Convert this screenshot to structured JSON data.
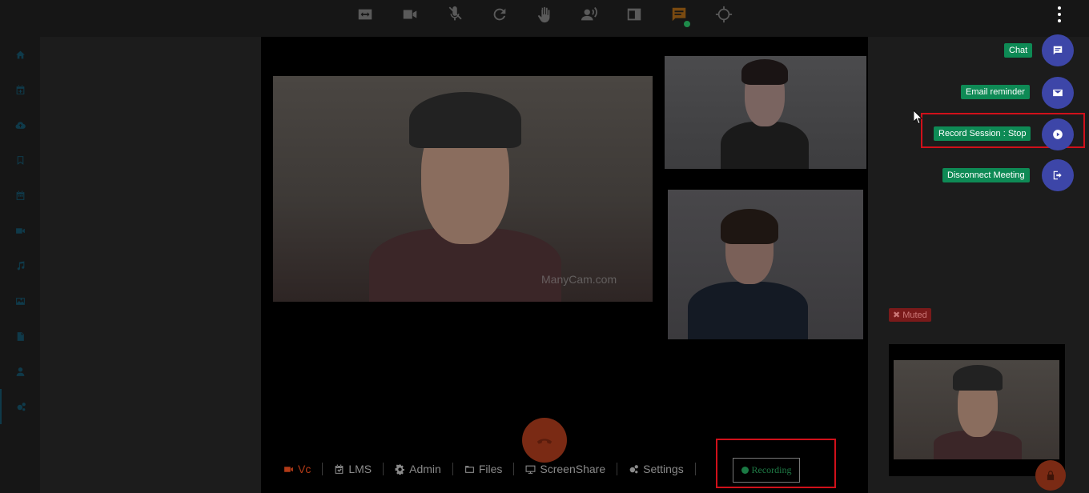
{
  "toolbar": {
    "items": [
      {
        "icon": "fit-screen-icon"
      },
      {
        "icon": "video-camera-icon"
      },
      {
        "icon": "mic-off-icon"
      },
      {
        "icon": "refresh-icon"
      },
      {
        "icon": "raise-hand-icon"
      },
      {
        "icon": "speaker-person-icon"
      },
      {
        "icon": "layout-icon"
      },
      {
        "icon": "chat-icon",
        "color": "#7a4a10"
      },
      {
        "icon": "crosshair-icon"
      }
    ],
    "chat_status_color": "#1e8a4a"
  },
  "sidebar": {
    "items": [
      {
        "icon": "home-icon"
      },
      {
        "icon": "calendar-add-icon"
      },
      {
        "icon": "cloud-upload-icon"
      },
      {
        "icon": "bookmark-icon"
      },
      {
        "icon": "calendar-icon"
      },
      {
        "icon": "video-icon"
      },
      {
        "icon": "music-icon"
      },
      {
        "icon": "image-icon"
      },
      {
        "icon": "document-icon"
      },
      {
        "icon": "user-icon"
      },
      {
        "icon": "cogs-icon",
        "active": true
      }
    ],
    "icon_color": "#0f3a4a"
  },
  "videos": {
    "watermark": "ManyCam.com"
  },
  "bottom_nav": {
    "vc": "Vc",
    "lms": "LMS",
    "admin": "Admin",
    "files": "Files",
    "screenshare": "ScreenShare",
    "settings": "Settings",
    "recording": "Recording",
    "active_color": "#b23a17"
  },
  "fab_menu": {
    "chat": "Chat",
    "email_reminder": "Email reminder",
    "record_session": "Record Session : Stop",
    "disconnect": "Disconnect Meeting",
    "fab_color": "#3d46a8",
    "label_color": "#0e8a55"
  },
  "self_view": {
    "muted_label": "Muted"
  },
  "highlight_color": "#d0101a"
}
